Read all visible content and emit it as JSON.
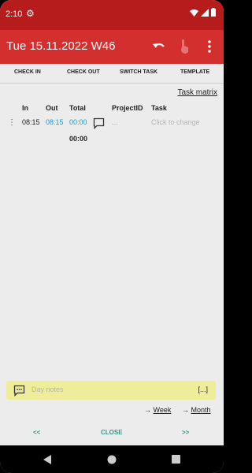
{
  "status_bar": {
    "time": "2:10"
  },
  "app_bar": {
    "title": "Tue 15.11.2022 W46"
  },
  "tabs": [
    {
      "label": "CHECK IN"
    },
    {
      "label": "CHECK OUT"
    },
    {
      "label": "SWITCH TASK"
    },
    {
      "label": "TEMPLATE"
    }
  ],
  "task_matrix_link": "Task matrix",
  "table": {
    "headers": {
      "in": "In",
      "out": "Out",
      "total": "Total",
      "project_id": "ProjectID",
      "task": "Task"
    },
    "rows": [
      {
        "in": "08:15",
        "out": "08:15",
        "total": "00:00",
        "project_id": "...",
        "task": "Click to change"
      }
    ],
    "day_total": "00:00"
  },
  "day_notes": {
    "placeholder": "Day notes",
    "button_label": "[...]"
  },
  "links": {
    "week": "Week",
    "month": "Month",
    "arrow": "→"
  },
  "footer": {
    "prev": "<<",
    "close": "CLOSE",
    "next": ">>"
  },
  "colors": {
    "status_bar": "#b71c1c",
    "app_bar": "#d32f2f",
    "accent_time": "#1e9bd7",
    "footer_text": "#2e9c8a",
    "notes_bg": "#eeee9a"
  }
}
